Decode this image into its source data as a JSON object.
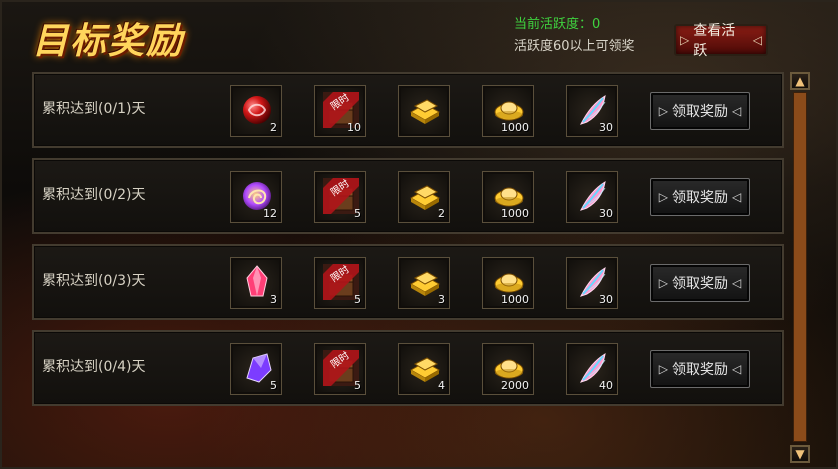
{
  "title": "目标奖励",
  "activity": {
    "current": "当前活跃度：0",
    "hint": "活跃度60以上可领奖",
    "view_button": "查看活跃"
  },
  "rows": [
    {
      "label": "累积达到(0/1)天",
      "items": [
        {
          "icon": "red-orb-icon",
          "count": "2"
        },
        {
          "icon": "limited-time-chest-icon",
          "count": "10"
        },
        {
          "icon": "gold-bars-icon",
          "count": ""
        },
        {
          "icon": "gold-ingot-icon",
          "count": "1000"
        },
        {
          "icon": "pink-feather-icon",
          "count": "30"
        }
      ],
      "claim": "领取奖励"
    },
    {
      "label": "累积达到(0/2)天",
      "items": [
        {
          "icon": "purple-swirl-icon",
          "count": "12"
        },
        {
          "icon": "limited-time-chest-icon",
          "count": "5"
        },
        {
          "icon": "gold-bars-icon",
          "count": "2"
        },
        {
          "icon": "gold-ingot-icon",
          "count": "1000"
        },
        {
          "icon": "pink-feather-icon",
          "count": "30"
        }
      ],
      "claim": "领取奖励"
    },
    {
      "label": "累积达到(0/3)天",
      "items": [
        {
          "icon": "red-crystal-icon",
          "count": "3"
        },
        {
          "icon": "limited-time-chest-icon",
          "count": "5"
        },
        {
          "icon": "gold-bars-icon",
          "count": "3"
        },
        {
          "icon": "gold-ingot-icon",
          "count": "1000"
        },
        {
          "icon": "pink-feather-icon",
          "count": "30"
        }
      ],
      "claim": "领取奖励"
    },
    {
      "label": "累积达到(0/4)天",
      "items": [
        {
          "icon": "purple-crystal-icon",
          "count": "5"
        },
        {
          "icon": "limited-time-chest-icon",
          "count": "5"
        },
        {
          "icon": "gold-bars-icon",
          "count": "4"
        },
        {
          "icon": "gold-ingot-icon",
          "count": "2000"
        },
        {
          "icon": "pink-feather-icon",
          "count": "40"
        }
      ],
      "claim": "领取奖励"
    }
  ],
  "colors": {
    "title": "#ffd55c",
    "activity_value": "#3fd23f",
    "scroll_track": "#8b4b1a"
  }
}
